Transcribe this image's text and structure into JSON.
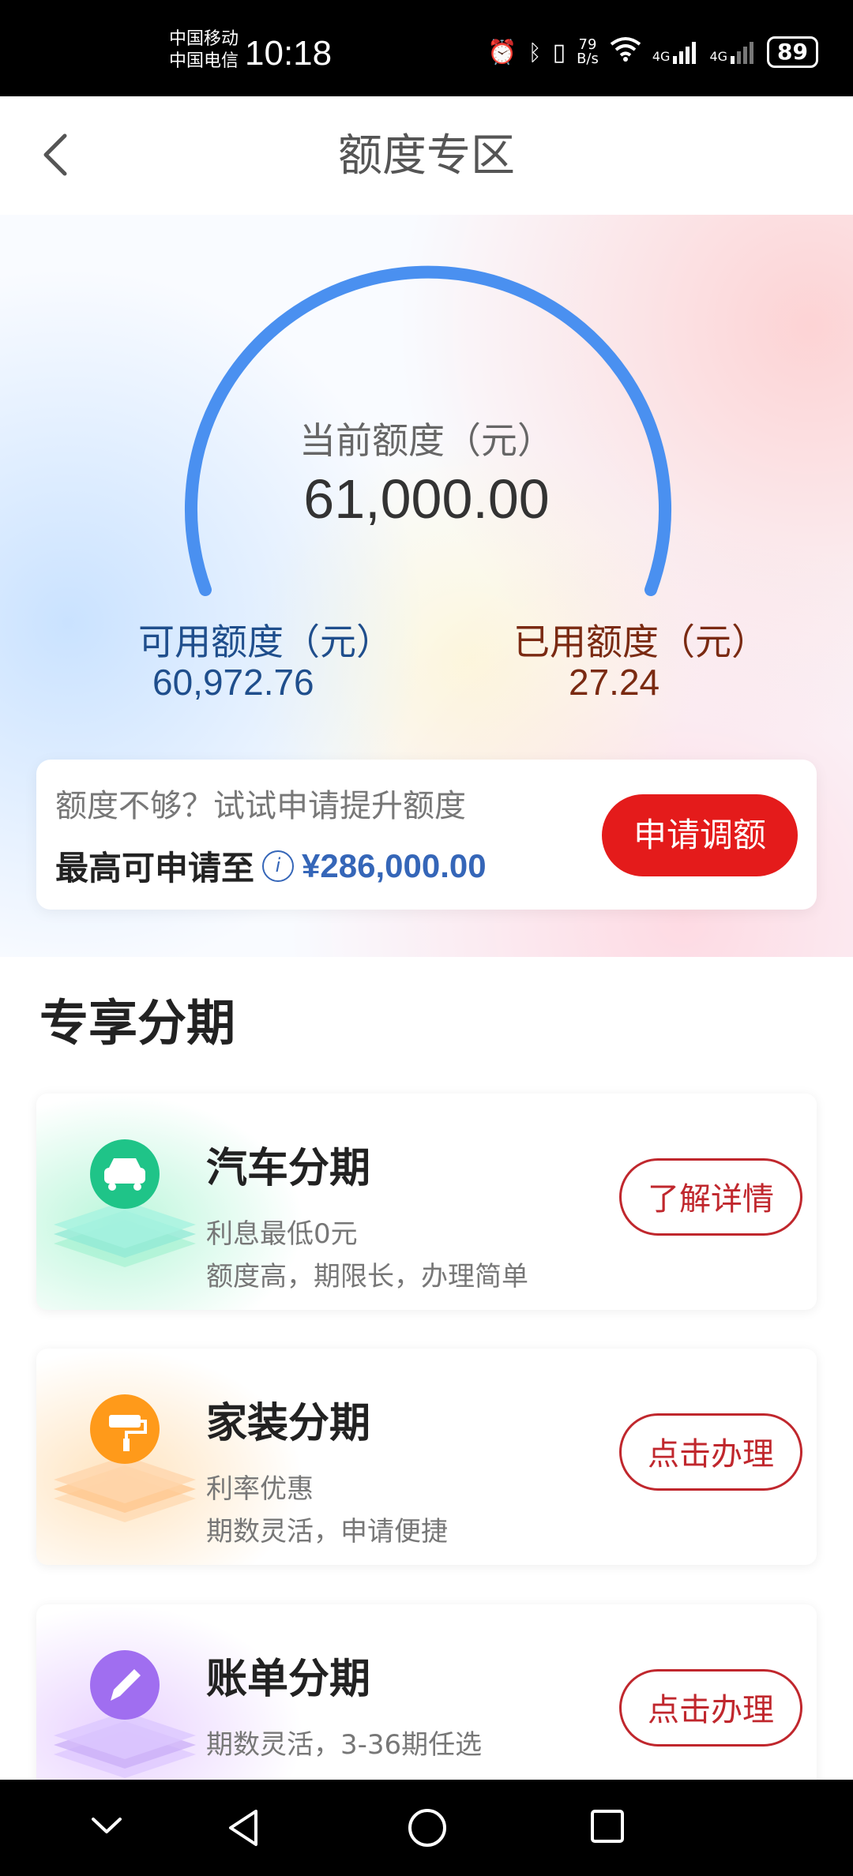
{
  "status_bar": {
    "carrier1": "中国移动",
    "carrier2": "中国电信",
    "time": "10:18",
    "speed_value": "79",
    "speed_unit": "B/s",
    "network1": "4G",
    "network2": "4G",
    "battery": "89"
  },
  "header": {
    "title": "额度专区"
  },
  "quota": {
    "current_label": "当前额度（元）",
    "current_value": "61,000.00",
    "available_label": "可用额度（元）",
    "available_value": "60,972.76",
    "used_label": "已用额度（元）",
    "used_value": "27.24",
    "accent_color": "#4a90f0"
  },
  "raise": {
    "hint": "额度不够？试试申请提升额度",
    "max_label": "最高可申请至",
    "max_amount": "¥286,000.00",
    "button": "申请调额"
  },
  "section": {
    "title": "专享分期"
  },
  "cards": [
    {
      "title": "汽车分期",
      "line1": "利息最低0元",
      "line2": "额度高，期限长，办理简单",
      "button": "了解详情",
      "icon": "car-icon",
      "color": "#22c48c"
    },
    {
      "title": "家装分期",
      "line1": "利率优惠",
      "line2": "期数灵活，申请便捷",
      "button": "点击办理",
      "icon": "paint-roller-icon",
      "color": "#ff9a1a"
    },
    {
      "title": "账单分期",
      "line1": "期数灵活，3-36期任选",
      "line2": "",
      "button": "点击办理",
      "icon": "pen-icon",
      "color": "#a06ef0"
    }
  ]
}
